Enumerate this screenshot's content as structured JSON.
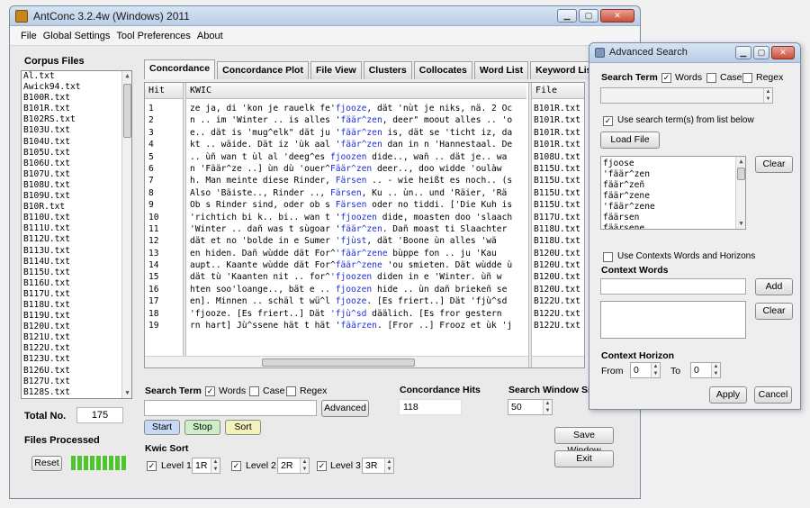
{
  "window": {
    "title": "AntConc 3.2.4w (Windows) 2011"
  },
  "menu": [
    "File",
    "Global Settings",
    "Tool Preferences",
    "About"
  ],
  "corpus": {
    "label": "Corpus Files",
    "files": [
      "Al.txt",
      "Awick94.txt",
      "B100R.txt",
      "B101R.txt",
      "B102RS.txt",
      "B103U.txt",
      "B104U.txt",
      "B105U.txt",
      "B106U.txt",
      "B107U.txt",
      "B108U.txt",
      "B109U.txt",
      "B10R.txt",
      "B110U.txt",
      "B111U.txt",
      "B112U.txt",
      "B113U.txt",
      "B114U.txt",
      "B115U.txt",
      "B116U.txt",
      "B117U.txt",
      "B118U.txt",
      "B119U.txt",
      "B120U.txt",
      "B121U.txt",
      "B122U.txt",
      "B123U.txt",
      "B126U.txt",
      "B127U.txt",
      "B128S.txt"
    ],
    "total_label": "Total No.",
    "total_value": "175",
    "processed_label": "Files Processed",
    "reset_label": "Reset"
  },
  "tabs": [
    "Concordance",
    "Concordance Plot",
    "File View",
    "Clusters",
    "Collocates",
    "Word List",
    "Keyword List"
  ],
  "concordance": {
    "col_hit": "Hit",
    "col_kwic": "KWIC",
    "col_file": "File",
    "rows": [
      {
        "hit": "1",
        "pre": "ze ja, di 'kon je rauelk fe'",
        "kw": "fjooze",
        "post": ", dät 'nùt je niks, nä. 2 Oc",
        "file": "B101R.txt"
      },
      {
        "hit": "2",
        "pre": "n .. im 'Winter .. is alles '",
        "kw": "fäär^zen",
        "post": ", deer\" moout alles .. 'o",
        "file": "B101R.txt"
      },
      {
        "hit": "3",
        "pre": "e.. dät is 'mug^elk\" dät ju '",
        "kw": "fäär^zen",
        "post": " is, dät se 'ticht iz, da",
        "file": "B101R.txt"
      },
      {
        "hit": "4",
        "pre": "kt .. wäide. Dät iz 'ùk aal '",
        "kw": "fäär^zen",
        "post": " dan in n 'Hannestaal. De",
        "file": "B101R.txt"
      },
      {
        "hit": "5",
        "pre": " .. ùñ wan t ùl al 'deeg^es ",
        "kw": "fjoozen",
        "post": " dide.., wañ .. dät je.. wa",
        "file": "B108U.txt"
      },
      {
        "hit": "6",
        "pre": "n 'Fäär^ze ..] ùn dù 'ouer^",
        "kw": "Fäär^zen",
        "post": " deer.., doo widde 'oulàw",
        "file": "B115U.txt"
      },
      {
        "hit": "7",
        "pre": "h. Man meinte diese Rinder, ",
        "kw": "Färsen",
        "post": " .. - wie heißt es noch.. (s",
        "file": "B115U.txt"
      },
      {
        "hit": "8",
        "pre": " Also 'Bäiste.., Rinder .., ",
        "kw": "Färsen",
        "post": ", Ku .. ùn.. und 'Räier, 'Rä",
        "file": "B115U.txt"
      },
      {
        "hit": "9",
        "pre": "Ob s Rinder sind, oder ob s ",
        "kw": "Färsen",
        "post": " oder no tiddi. ['Die Kuh is",
        "file": "B115U.txt"
      },
      {
        "hit": "10",
        "pre": "'richtich bi k.. bi.. wan t '",
        "kw": "fjoozen",
        "post": " dide, moasten doo 'slaach",
        "file": "B117U.txt"
      },
      {
        "hit": "11",
        "pre": "'Winter .. dañ was t sùgoar '",
        "kw": "fäär^zen",
        "post": ". Dañ moast ti Slaachter",
        "file": "B118U.txt"
      },
      {
        "hit": "12",
        "pre": "dät et no 'bolde in e Sumer ",
        "kw": "'fjùst",
        "post": ", dät 'Boone ùn alles 'wä",
        "file": "B118U.txt"
      },
      {
        "hit": "13",
        "pre": "en hiden. Dañ wùdde dät For^",
        "kw": "'fäär^zene",
        "post": " bùppe fon .. ju 'Kau",
        "file": "B120U.txt"
      },
      {
        "hit": "14",
        "pre": "aupt.. Kaante wùdde dät For^",
        "kw": "fäär^zene",
        "post": " 'ou smieten. Dät wùdde ù",
        "file": "B120U.txt"
      },
      {
        "hit": "15",
        "pre": " dät tù 'Kaanten nit .. for^",
        "kw": "'fjoozen",
        "post": " diden in e 'Winter.  ùñ w",
        "file": "B120U.txt"
      },
      {
        "hit": "16",
        "pre": "hten soo'loange.., bät e .. ",
        "kw": "fjoozen",
        "post": " hide .. ùn dañ briekeñ se",
        "file": "B120U.txt"
      },
      {
        "hit": "17",
        "pre": "en]. Minnen .. schäl t wü^l ",
        "kw": "fjooze",
        "post": ". [Es friert..] Dät 'fjù^sd",
        "file": "B122U.txt"
      },
      {
        "hit": "18",
        "pre": " 'fjooze. [Es friert..] Dät ",
        "kw": "'fjù^sd",
        "post": " däälich. [Es fror gestern",
        "file": "B122U.txt"
      },
      {
        "hit": "19",
        "pre": "rn hart] Jù^ssene hät t hät '",
        "kw": "fäärzen",
        "post": ". [Fror ..] Frooz et ùk 'j",
        "file": "B122U.txt"
      }
    ]
  },
  "search": {
    "term_label": "Search Term",
    "words_label": "Words",
    "case_label": "Case",
    "regex_label": "Regex",
    "words_checked": true,
    "case_checked": false,
    "regex_checked": false,
    "term_value": "",
    "advanced_label": "Advanced",
    "hits_label": "Concordance Hits",
    "hits_value": "118",
    "window_label": "Search Window Siz",
    "window_value": "50",
    "start_label": "Start",
    "stop_label": "Stop",
    "sort_label": "Sort",
    "kwic_sort_label": "Kwic Sort",
    "level1_label": "Level 1",
    "level1_value": "1R",
    "level2_label": "Level 2",
    "level2_value": "2R",
    "level3_label": "Level 3",
    "level3_value": "3R",
    "save_window_label": "Save Window",
    "exit_label": "Exit"
  },
  "advanced": {
    "title": "Advanced Search",
    "term_label": "Search Term",
    "words_label": "Words",
    "case_label": "Case",
    "regex_label": "Regex",
    "use_list_label": "Use search term(s) from list below",
    "load_file_label": "Load File",
    "terms": [
      "fjoose",
      "'fäär^zen",
      "fäär^zeñ",
      "fäär^zene",
      "'fäär^zene",
      "fäärsen",
      "fäärsene"
    ],
    "clear_label": "Clear",
    "use_context_label": "Use Contexts Words and Horizons",
    "context_words_label": "Context Words",
    "add_label": "Add",
    "clear2_label": "Clear",
    "horizon_label": "Context Horizon",
    "from_label": "From",
    "from_value": "0",
    "to_label": "To",
    "to_value": "0",
    "apply_label": "Apply",
    "cancel_label": "Cancel"
  },
  "colors": {
    "keyword": "#1c2fd6",
    "start_btn": "#c7d9f5",
    "stop_btn": "#cdeec6",
    "sort_btn": "#f5f1bd",
    "progress": "#4fc42e"
  }
}
